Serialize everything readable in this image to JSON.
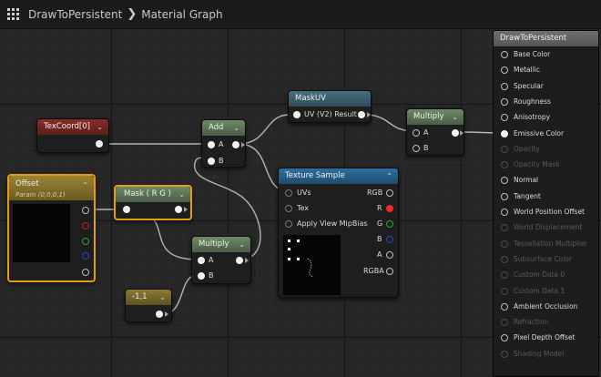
{
  "breadcrumb": {
    "asset": "DrawToPersistent",
    "separator": "❯",
    "graph": "Material Graph"
  },
  "colors": {
    "canvas": "#262626",
    "selection": "#e79a17",
    "wire": "#b4b4b4",
    "pin_red": "#d02020",
    "pin_green": "#2bb52b",
    "pin_blue": "#2a45c8"
  },
  "nodes": {
    "texcoord": {
      "title": "TexCoord[0]",
      "collapse": "⌄"
    },
    "add": {
      "title": "Add",
      "collapse": "⌄",
      "input_a": "A",
      "input_b": "B"
    },
    "maskuv": {
      "title": "MaskUV",
      "output": "UV (V2) Result"
    },
    "multiply_top": {
      "title": "Multiply",
      "collapse": "⌄",
      "input_a": "A",
      "input_b": "B"
    },
    "offset": {
      "title": "Offset",
      "subtitle": "Param (0,0,0,1)",
      "collapse": "⌃"
    },
    "mask": {
      "title": "Mask ( R G )",
      "collapse": "⌄"
    },
    "texture_sample": {
      "title": "Texture Sample",
      "collapse": "⌃",
      "inputs": [
        "UVs",
        "Tex",
        "Apply View MipBias"
      ],
      "outputs": [
        "RGB",
        "R",
        "G",
        "B",
        "A",
        "RGBA"
      ]
    },
    "multiply_bottom": {
      "title": "Multiply",
      "collapse": "⌄",
      "input_a": "A",
      "input_b": "B"
    },
    "constant": {
      "title": "-1,1",
      "collapse": "⌄"
    }
  },
  "result_node": {
    "title": "DrawToPersistent",
    "pins": [
      {
        "label": "Base Color",
        "enabled": true,
        "connected": false
      },
      {
        "label": "Metallic",
        "enabled": true,
        "connected": false
      },
      {
        "label": "Specular",
        "enabled": true,
        "connected": false
      },
      {
        "label": "Roughness",
        "enabled": true,
        "connected": false
      },
      {
        "label": "Anisotropy",
        "enabled": true,
        "connected": false
      },
      {
        "label": "Emissive Color",
        "enabled": true,
        "connected": true
      },
      {
        "label": "Opacity",
        "enabled": false,
        "connected": false
      },
      {
        "label": "Opacity Mask",
        "enabled": false,
        "connected": false
      },
      {
        "label": "Normal",
        "enabled": true,
        "connected": false
      },
      {
        "label": "Tangent",
        "enabled": true,
        "connected": false
      },
      {
        "label": "World Position Offset",
        "enabled": true,
        "connected": false
      },
      {
        "label": "World Displacement",
        "enabled": false,
        "connected": false
      },
      {
        "label": "Tessellation Multiplier",
        "enabled": false,
        "connected": false
      },
      {
        "label": "Subsurface Color",
        "enabled": false,
        "connected": false
      },
      {
        "label": "Custom Data 0",
        "enabled": false,
        "connected": false
      },
      {
        "label": "Custom Data 1",
        "enabled": false,
        "connected": false
      },
      {
        "label": "Ambient Occlusion",
        "enabled": true,
        "connected": false
      },
      {
        "label": "Refraction",
        "enabled": false,
        "connected": false
      },
      {
        "label": "Pixel Depth Offset",
        "enabled": true,
        "connected": false
      },
      {
        "label": "Shading Model",
        "enabled": false,
        "connected": false
      }
    ]
  }
}
